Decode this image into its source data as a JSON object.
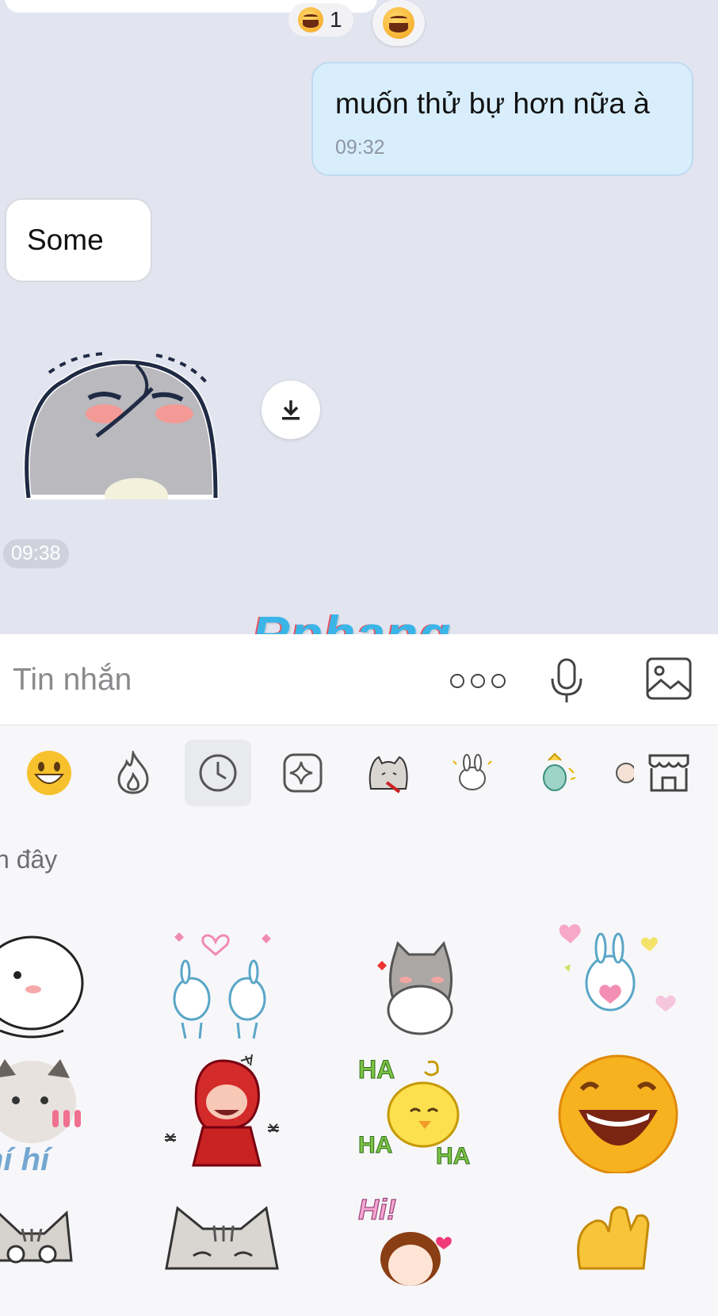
{
  "chat": {
    "reaction": {
      "emoji_icon": "laughing-face-icon",
      "count": "1"
    },
    "outgoing": {
      "text": "muốn thử bự hơn nữa à",
      "time": "09:32"
    },
    "incoming": {
      "text": "Some"
    },
    "sticker_time": "09:38",
    "watermark": "Rphang"
  },
  "input": {
    "placeholder": "Tin nhắn"
  },
  "sticker_panel": {
    "tabs": [
      "emoji-icon",
      "fire-icon",
      "clock-icon",
      "sparkle-icon",
      "cat-sticker-pack",
      "bunny-sticker-pack",
      "cactus-sticker-pack",
      "partial-sticker-pack"
    ],
    "active_tab": "clock-icon",
    "section_label": "n đây",
    "partial_text": "hí hí",
    "hi_text": "Hi!",
    "haha_text": "HA"
  },
  "colors": {
    "chat_bg": "#e2e4ef",
    "outgoing_bubble": "#d8eefc",
    "panel_bg": "#f7f7f9"
  }
}
